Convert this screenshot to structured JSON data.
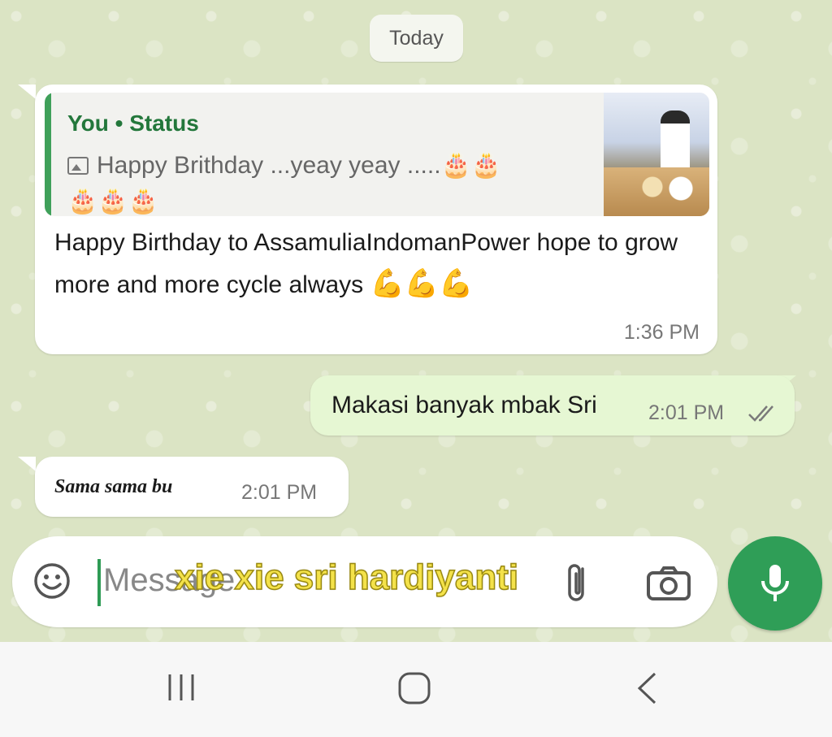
{
  "date_chip": "Today",
  "messages": [
    {
      "direction": "incoming",
      "quote": {
        "author": "You",
        "separator": "•",
        "source": "Status",
        "text": "Happy Brithday ...yeay yeay .....",
        "emoji_line1": "🎂🎂",
        "emoji_line2": "🎂🎂🎂"
      },
      "text": "Happy Birthday to AssamuliaIndomanPower hope to grow more and more cycle always",
      "emoji": "💪💪💪",
      "time": "1:36 PM"
    },
    {
      "direction": "outgoing",
      "text": "Makasi banyak mbak Sri",
      "time": "2:01 PM",
      "status": "read"
    },
    {
      "direction": "incoming",
      "text": "Sama sama bu",
      "time": "2:01 PM"
    }
  ],
  "composer": {
    "placeholder": "Message",
    "overlay_caption": "xie xie sri hardiyanti"
  },
  "icons": {
    "emoji": "emoji-icon",
    "attach": "paperclip-icon",
    "camera": "camera-icon",
    "mic": "mic-icon"
  },
  "colors": {
    "accent_green": "#2f9e57",
    "outgoing_bubble": "#e6f7d3",
    "incoming_bubble": "#ffffff",
    "chat_background": "#dbe4c4",
    "quote_bar": "#3fa05a"
  }
}
